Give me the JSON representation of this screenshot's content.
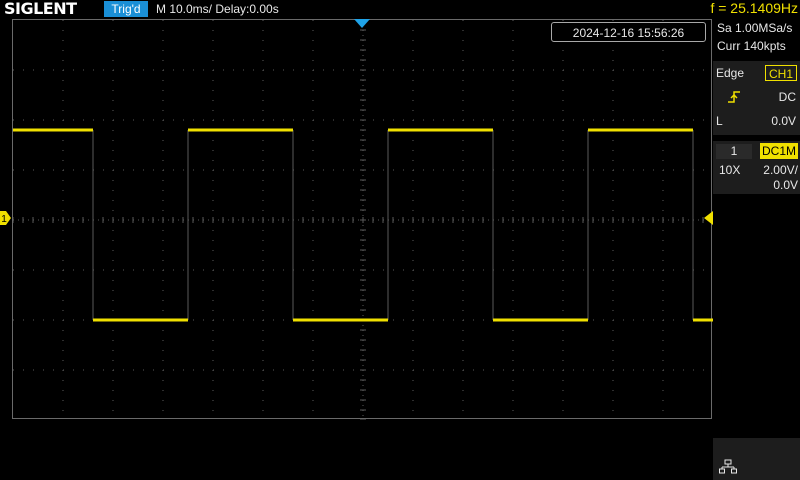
{
  "header": {
    "brand": "SIGLENT",
    "trigger_status": "Trig'd",
    "timebase": "M 10.0ms/ Delay:0.00s",
    "frequency": "f = 25.1409Hz"
  },
  "screen": {
    "timestamp": "2024-12-16 15:56:26"
  },
  "acquisition": {
    "sample_rate": "Sa 1.00MSa/s",
    "memory_depth": "Curr 140kpts"
  },
  "trigger": {
    "type": "Edge",
    "source": "CH1",
    "slope_icon": "rising-edge-icon",
    "coupling": "DC",
    "level_label": "L",
    "level": "0.0V"
  },
  "channel1": {
    "number": "1",
    "coupling": "DC1M",
    "probe": "10X",
    "scale": "2.00V/",
    "offset": "0.0V",
    "marker_label": "1"
  },
  "network": {
    "icon": "network-icon"
  },
  "colors": {
    "ch1": "#f0e000",
    "trigger_badge": "#1a8fd6",
    "panel_bg": "#1d1d1d",
    "grid": "#5a5a5a"
  },
  "waveform": {
    "type": "square",
    "period_div": 4.0,
    "high_div": 1.8,
    "low_div": -2.0,
    "rising_edges_div": [
      -3.5,
      0.5,
      4.5
    ],
    "falling_edges_div": [
      -5.4,
      -1.4,
      2.6,
      6.6
    ]
  }
}
